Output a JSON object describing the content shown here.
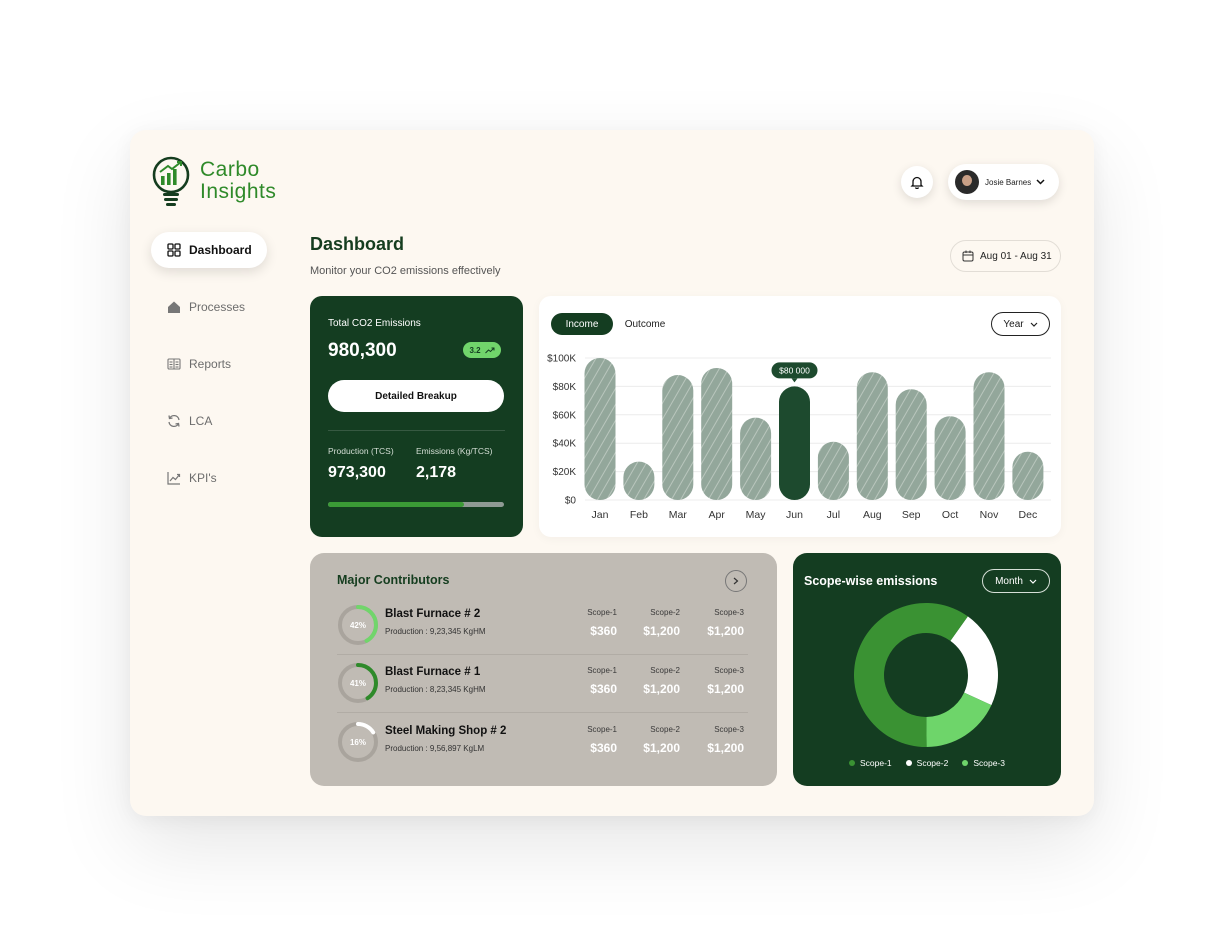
{
  "brand": {
    "line1": "Carbo",
    "line2": "Insights"
  },
  "nav": [
    {
      "label": "Dashboard",
      "icon": "grid-icon",
      "active": true
    },
    {
      "label": "Processes",
      "icon": "home-icon"
    },
    {
      "label": "Reports",
      "icon": "reports-icon"
    },
    {
      "label": "LCA",
      "icon": "refresh-icon"
    },
    {
      "label": "KPI's",
      "icon": "trend-icon"
    }
  ],
  "user": {
    "name": "Josie Barnes"
  },
  "header": {
    "title": "Dashboard",
    "subtitle": "Monitor your CO2 emissions effectively",
    "date_range": "Aug 01 - Aug 31"
  },
  "emissions": {
    "label": "Total CO2 Emissions",
    "value": "980,300",
    "badge": "3.2",
    "button": "Detailed Breakup",
    "production_label": "Production (TCS)",
    "production_value": "973,300",
    "intensity_label": "Emissions (Kg/TCS)",
    "intensity_value": "2,178",
    "progress": 0.77
  },
  "chart_tabs": {
    "income": "Income",
    "outcome": "Outcome",
    "period": "Year"
  },
  "chart_data": {
    "type": "bar",
    "categories": [
      "Jan",
      "Feb",
      "Mar",
      "Apr",
      "May",
      "Jun",
      "Jul",
      "Aug",
      "Sep",
      "Oct",
      "Nov",
      "Dec"
    ],
    "values": [
      100000,
      27000,
      88000,
      93000,
      58000,
      80000,
      41000,
      90000,
      78000,
      59000,
      90000,
      34000
    ],
    "highlight_index": 5,
    "tooltip": "$80 000",
    "ylim": [
      0,
      100000
    ],
    "yticks": [
      "$0",
      "$20K",
      "$40K",
      "$60K",
      "$80K",
      "$100K"
    ],
    "colors": {
      "bar": "#93a79b",
      "highlight": "#1d4a2e"
    }
  },
  "contributors": {
    "title": "Major Contributors",
    "rows": [
      {
        "percent_label": "42%",
        "percent": 0.42,
        "color": "#71d56b",
        "name": "Blast Furnace # 2",
        "production": "Production : 9,23,345 KgHM",
        "s1_label": "Scope-1",
        "s1": "$360",
        "s2_label": "Scope-2",
        "s2": "$1,200",
        "s3_label": "Scope-3",
        "s3": "$1,200"
      },
      {
        "percent_label": "41%",
        "percent": 0.41,
        "color": "#2e8a2a",
        "name": "Blast Furnace # 1",
        "production": "Production : 8,23,345 KgHM",
        "s1_label": "Scope-1",
        "s1": "$360",
        "s2_label": "Scope-2",
        "s2": "$1,200",
        "s3_label": "Scope-3",
        "s3": "$1,200"
      },
      {
        "percent_label": "16%",
        "percent": 0.16,
        "color": "#ffffff",
        "name": "Steel Making Shop # 2",
        "production": "Production : 9,56,897 KgLM",
        "s1_label": "Scope-1",
        "s1": "$360",
        "s2_label": "Scope-2",
        "s2": "$1,200",
        "s3_label": "Scope-3",
        "s3": "$1,200"
      }
    ]
  },
  "scope": {
    "title": "Scope-wise emissions",
    "period": "Month",
    "slices": [
      {
        "name": "Scope-1",
        "value": 0.6,
        "color": "#3a9233"
      },
      {
        "name": "Scope-2",
        "value": 0.22,
        "color": "#ffffff"
      },
      {
        "name": "Scope-3",
        "value": 0.18,
        "color": "#6ed56a"
      }
    ]
  }
}
